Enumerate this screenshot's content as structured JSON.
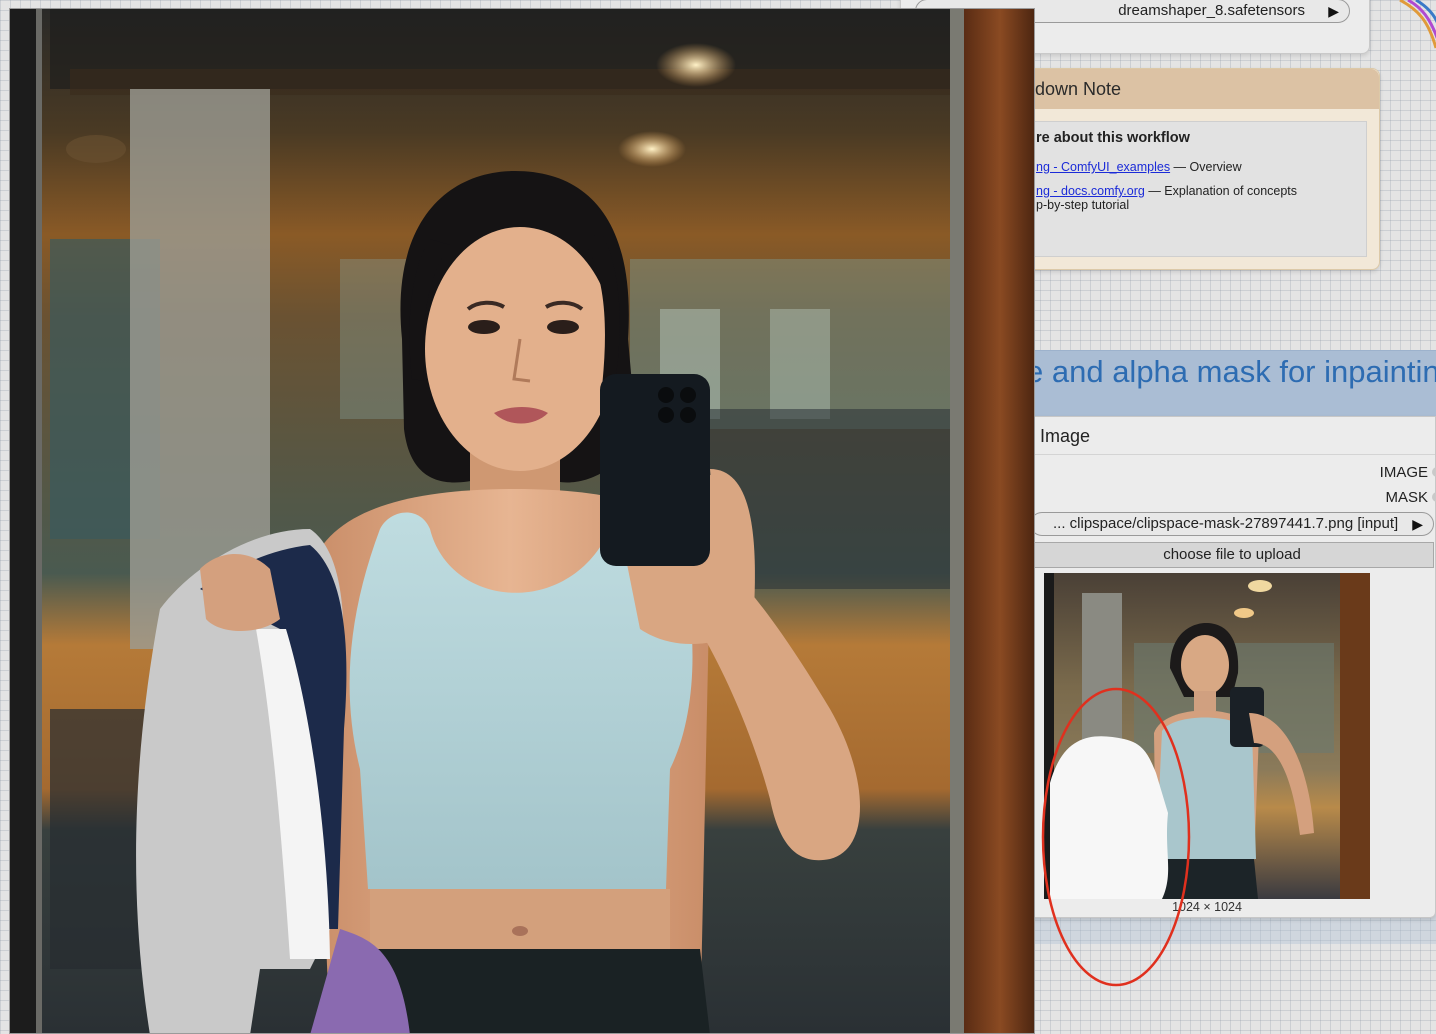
{
  "checkpoint_node": {
    "ckpt_name_value": "dreamshaper_8.safetensors"
  },
  "note_node": {
    "title": "down Note",
    "heading": "re about this workflow",
    "lines": [
      {
        "link": "ng - ComfyUI_examples",
        "text": " — Overview"
      },
      {
        "link": "ng - docs.comfy.org",
        "text": " — Explanation of concepts"
      },
      {
        "link": "",
        "text": "p-by-step tutorial"
      }
    ]
  },
  "group": {
    "title": "e and alpha mask for inpaintin"
  },
  "load_image_node": {
    "title": "d Image",
    "outputs": [
      "IMAGE",
      "MASK"
    ],
    "image_value": "... clipspace/clipspace-mask-27897441.7.png [input]",
    "upload_label": "choose file to upload",
    "image_size": "1024 × 1024"
  },
  "icons": {
    "combo_arrow": "▶"
  },
  "colors": {
    "annotation_ring": "#e0301e",
    "group_title": "#2d6cb2",
    "link": "#1b2bd8"
  }
}
